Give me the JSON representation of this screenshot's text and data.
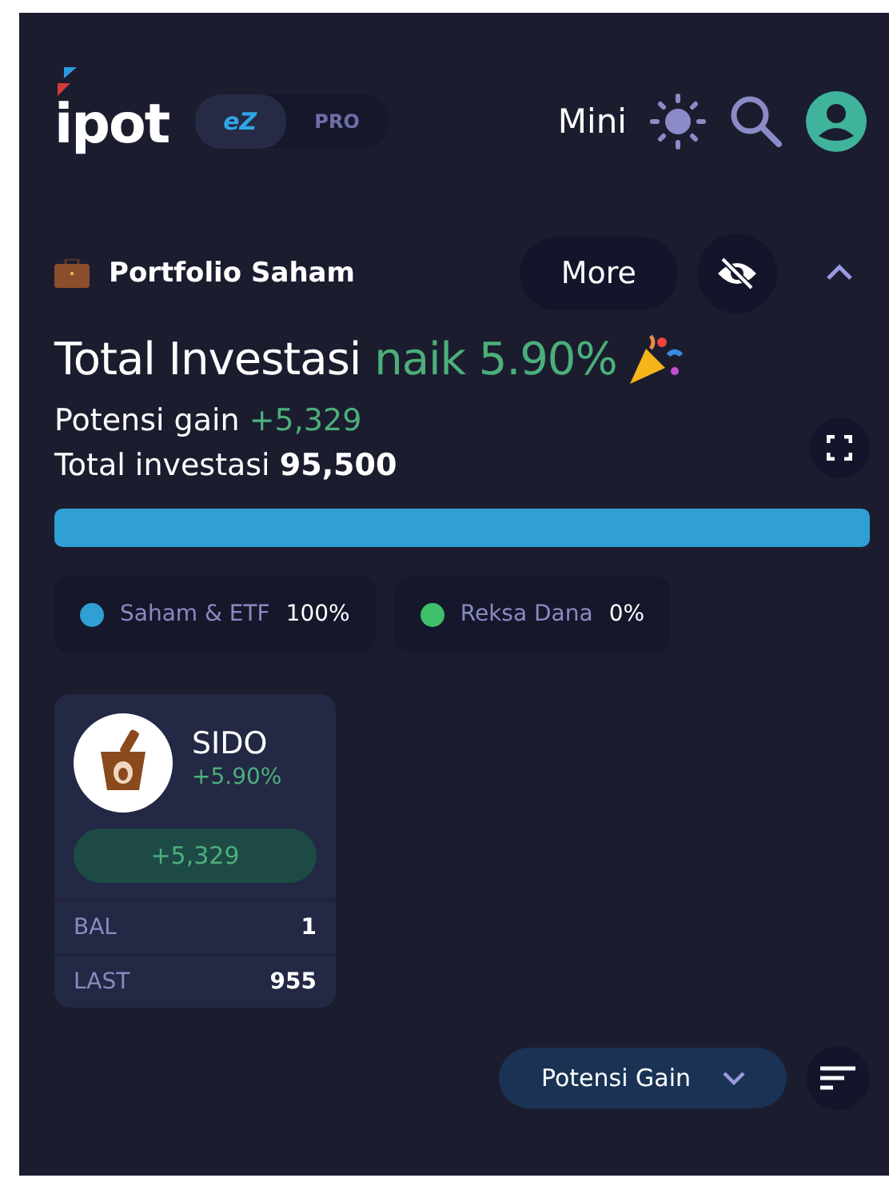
{
  "header": {
    "logo": "ipot",
    "mode_toggle": [
      {
        "label": "eZ",
        "selected": true
      },
      {
        "label": "PRO",
        "selected": false
      }
    ],
    "view_label": "Mini"
  },
  "portfolio": {
    "title": "Portfolio Saham",
    "more_button": "More",
    "expanded": true,
    "headline": {
      "text": "Total Investasi",
      "change": "naik 5.90%"
    },
    "gain": {
      "label": "Potensi gain",
      "value": "+5,329"
    },
    "total": {
      "label": "Total investasi",
      "value": "95,500"
    },
    "allocation": {
      "level": 1
    },
    "legend": [
      {
        "label": "Saham & ETF",
        "value": "100%",
        "color": "#2f9fd4"
      },
      {
        "label": "Reksa Dana",
        "value": "0%",
        "color": "#3fbf6a"
      }
    ],
    "stocks": [
      {
        "code": "SIDO",
        "change": "+5.90%",
        "gain": "+5,329",
        "rows": [
          {
            "label": "BAL",
            "value": "1"
          },
          {
            "label": "LAST",
            "value": "955"
          }
        ]
      }
    ]
  },
  "sort": {
    "value": "Potensi Gain"
  }
}
